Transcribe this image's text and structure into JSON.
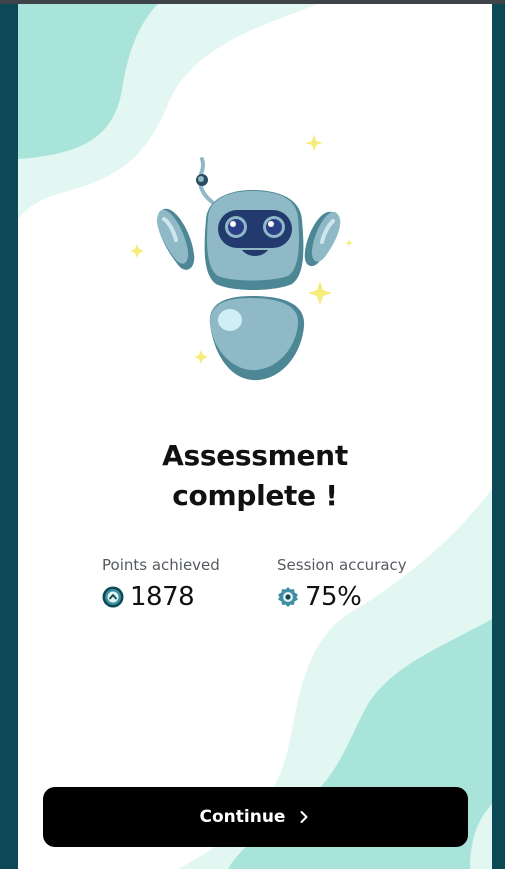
{
  "colors": {
    "frame": "#0c4956",
    "wave_light": "#e2f6f2",
    "wave_mid": "#a9e4da",
    "button": "#000000",
    "robot_body": "#8fb9c7",
    "robot_shadow": "#4d8796",
    "sparkle": "#f6ec7a"
  },
  "illustration": {
    "name": "robot-mascot"
  },
  "title": {
    "line1": "Assessment",
    "line2": "complete !"
  },
  "stats": {
    "points": {
      "label": "Points achieved",
      "value": "1878",
      "icon": "points-coin-icon"
    },
    "accuracy": {
      "label": "Session accuracy",
      "value": "75%",
      "icon": "target-icon"
    }
  },
  "button": {
    "label": "Continue",
    "icon": "chevron-right-icon"
  }
}
